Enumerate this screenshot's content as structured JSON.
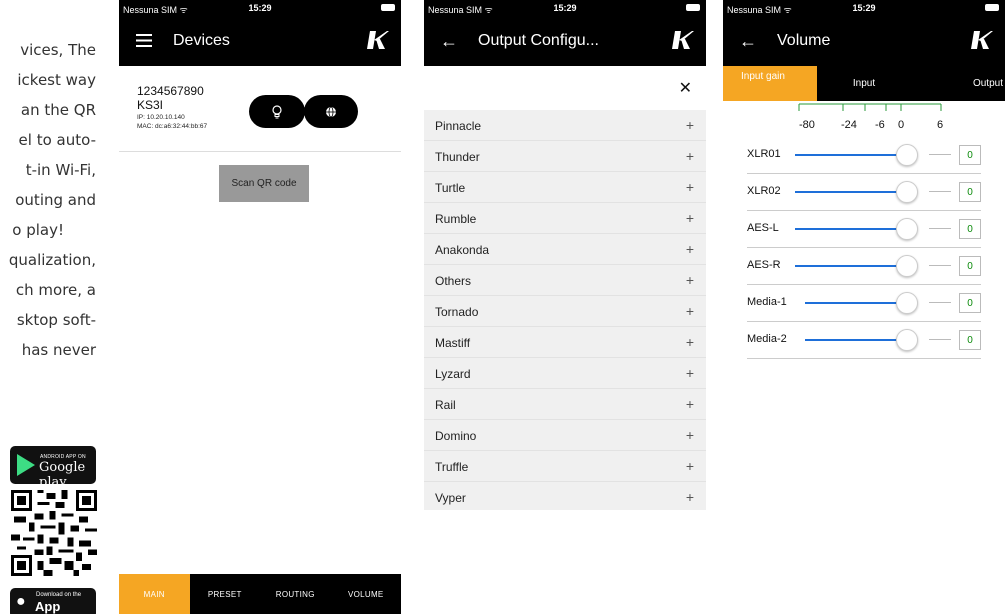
{
  "promo": {
    "lines": [
      "vices,  The",
      "ickest way",
      "an  the  QR",
      "el  to  auto-",
      "t-in  Wi-Fi,",
      "outing  and",
      "o play!",
      "qualization,",
      "ch  more,  a",
      "sktop  soft-",
      "has  never"
    ],
    "google_badge_small": "ANDROID APP ON",
    "google_badge_big": "Google play",
    "apple_badge_small": "Download on the",
    "apple_badge_big": "App Store"
  },
  "status_bar": {
    "carrier": "Nessuna SIM ᯤ",
    "time": "15:29"
  },
  "devices_screen": {
    "title": "Devices",
    "menu_icon": "menu-icon",
    "device": {
      "serial": "1234567890",
      "model": "KS3I",
      "ip": "IP: 10.20.10.140",
      "mac": "MAC: dc:a6:32:44:bb:67",
      "identify_icon": "bulb-icon",
      "web_icon": "globe-icon"
    },
    "scan_label": "Scan QR code",
    "bottom_nav": [
      {
        "label": "MAIN",
        "active": true
      },
      {
        "label": "PRESET",
        "active": false
      },
      {
        "label": "ROUTING",
        "active": false
      },
      {
        "label": "VOLUME",
        "active": false
      }
    ]
  },
  "output_screen": {
    "title": "Output Configu...",
    "back_icon": "arrow-left-icon",
    "close_icon": "close-icon",
    "items": [
      "Pinnacle",
      "Thunder",
      "Turtle",
      "Rumble",
      "Anakonda",
      "Others",
      "Tornado",
      "Mastiff",
      "Lyzard",
      "Rail",
      "Domino",
      "Truffle",
      "Vyper"
    ],
    "item_action": "+"
  },
  "volume_screen": {
    "title": "Volume",
    "tabs": [
      "Input gain",
      "Input",
      "Output"
    ],
    "scale_labels": [
      "-80",
      "-24",
      "-6",
      "0",
      "6"
    ],
    "channels": [
      {
        "name": "XLR01",
        "value": "0"
      },
      {
        "name": "XLR02",
        "value": "0"
      },
      {
        "name": "AES-L",
        "value": "0"
      },
      {
        "name": "AES-R",
        "value": "0"
      },
      {
        "name": "Media-1",
        "value": "0"
      },
      {
        "name": "Media-2",
        "value": "0"
      }
    ],
    "accent": "#1e6fd9",
    "value_color": "#0a8a0a"
  },
  "colors": {
    "accent": "#f5a623",
    "bar": "#000000"
  }
}
